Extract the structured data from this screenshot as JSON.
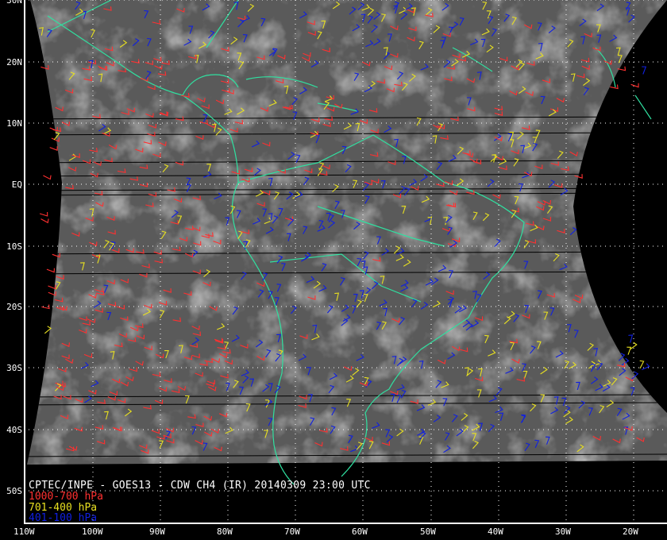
{
  "title": "CPTEC/INPE - GOES13 - CDW CH4 (IR) 20140309 23:00 UTC",
  "legend": [
    {
      "label": "1000-700 hPa",
      "color": "#ff3030"
    },
    {
      "label": "701-400 hPa",
      "color": "#e8e020"
    },
    {
      "label": "401-100 hPa",
      "color": "#1020e0"
    }
  ],
  "lat_labels": [
    "30N",
    "20N",
    "10N",
    "EQ",
    "10S",
    "20S",
    "30S",
    "40S",
    "50S"
  ],
  "lon_labels": [
    "110W",
    "100W",
    "90W",
    "80W",
    "70W",
    "60W",
    "50W",
    "40W",
    "30W",
    "20W"
  ],
  "colors": {
    "coast": "#30e0a0",
    "grid": "#ffffff"
  }
}
